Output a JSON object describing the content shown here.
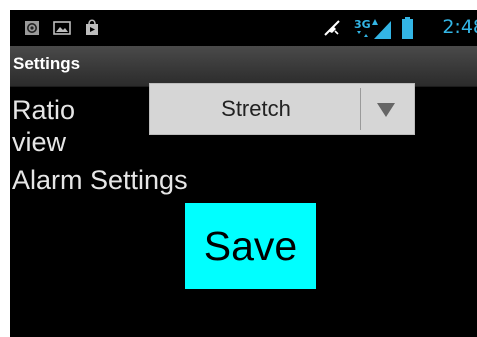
{
  "status_bar": {
    "time": "2:48",
    "network": "3G",
    "icons": [
      "at-sign-icon",
      "image-icon",
      "shopping-bag-icon",
      "mute-icon",
      "signal-icon",
      "battery-icon"
    ]
  },
  "title_bar": {
    "title": "Settings"
  },
  "main": {
    "ratio_label_line1": "Ratio",
    "ratio_label_line2": "view",
    "ratio_spinner": {
      "selected": "Stretch"
    },
    "alarm_label": "Alarm Settings",
    "save_label": "Save"
  },
  "colors": {
    "background": "#000000",
    "save_button": "#00ffff",
    "status_accent": "#33b5e5",
    "spinner_bg": "#d6d6d6"
  }
}
